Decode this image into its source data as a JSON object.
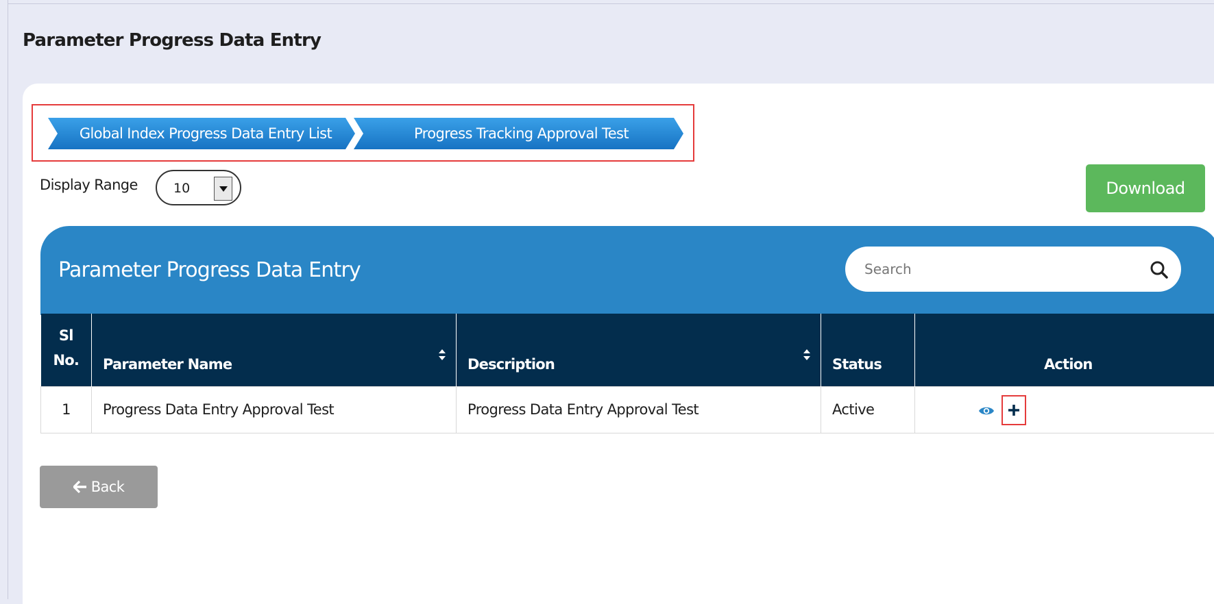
{
  "page": {
    "title": "Parameter Progress Data Entry"
  },
  "breadcrumb": {
    "items": [
      {
        "label": "Global Index Progress Data Entry List"
      },
      {
        "label": "Progress Tracking Approval Test"
      }
    ]
  },
  "display_range": {
    "label": "Display Range",
    "value": "10"
  },
  "download": {
    "label": "Download"
  },
  "panel": {
    "title": "Parameter Progress Data Entry",
    "search_placeholder": "Search"
  },
  "table": {
    "headers": {
      "sl_no_line1": "Sl",
      "sl_no_line2": "No.",
      "parameter_name": "Parameter Name",
      "description": "Description",
      "status": "Status",
      "action": "Action"
    },
    "rows": [
      {
        "sl_no": "1",
        "parameter_name": "Progress Data Entry Approval Test",
        "description": "Progress Data Entry Approval Test",
        "status": "Active"
      }
    ]
  },
  "back": {
    "label": "Back"
  },
  "colors": {
    "accent_blue": "#2a86c6",
    "header_navy": "#032d4d",
    "download_green": "#5cb85c",
    "status_green": "#2e9e2e",
    "highlight_red": "#e53b3b"
  },
  "icons": [
    "chevron-down-icon",
    "search-icon",
    "sort-icon",
    "eye-icon",
    "plus-icon",
    "arrow-left-icon"
  ]
}
